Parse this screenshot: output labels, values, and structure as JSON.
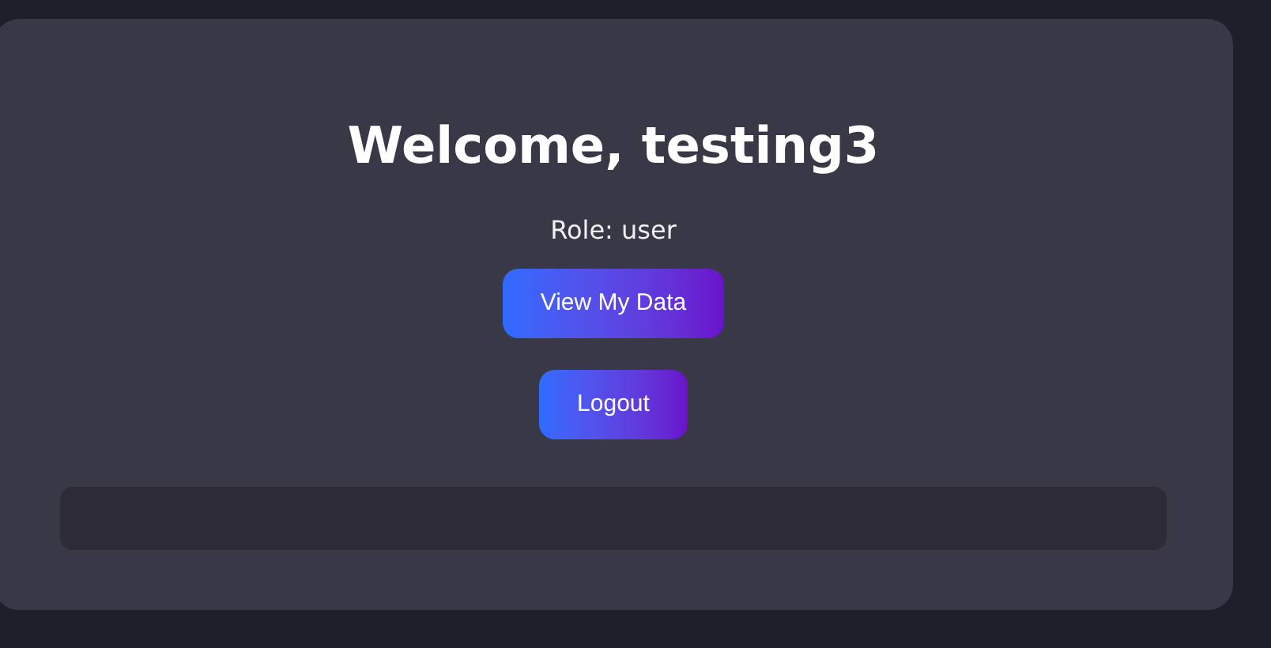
{
  "title": "Welcome, testing3",
  "role": "Role: user",
  "buttons": [
    {
      "label": "View My Data"
    },
    {
      "label": "Logout"
    }
  ]
}
